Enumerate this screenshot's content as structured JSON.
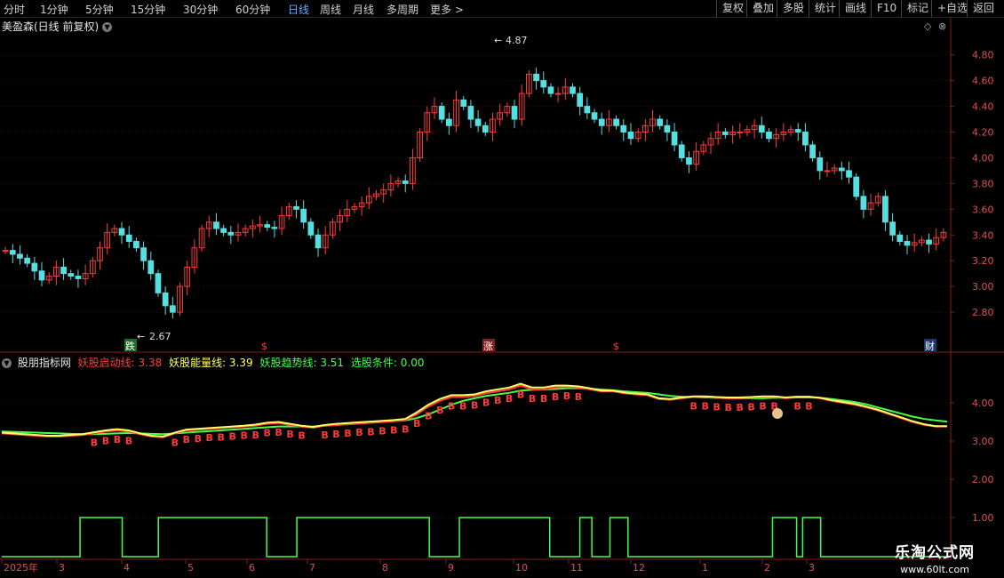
{
  "toolbar": {
    "periods": [
      "分时",
      "1分钟",
      "5分钟",
      "15分钟",
      "30分钟",
      "60分钟",
      "日线",
      "周线",
      "月线",
      "多周期",
      "更多 >"
    ],
    "active_period": "日线",
    "right_buttons": [
      "复权",
      "叠加",
      "多股",
      "统计",
      "画线",
      "F10",
      "标记",
      "+自选",
      "返回"
    ]
  },
  "main_chart": {
    "stock_title": "美盈森(日线 前复权)",
    "high_label": "4.87",
    "low_label": "2.67",
    "y_ticks": [
      "4.80",
      "4.60",
      "4.40",
      "4.20",
      "4.00",
      "3.80",
      "3.60",
      "3.40",
      "3.20",
      "3.00",
      "2.80"
    ],
    "markers": [
      {
        "text": "跌",
        "type": "box-green"
      },
      {
        "text": "$",
        "type": "red"
      },
      {
        "text": "涨",
        "type": "box-red"
      },
      {
        "text": "$",
        "type": "red"
      },
      {
        "text": "财",
        "type": "box-blue"
      }
    ]
  },
  "indicator": {
    "name": "股朋指标网",
    "lines": [
      {
        "label": "妖股启动线: 3.38",
        "color": "#ff3b3b"
      },
      {
        "label": "妖股能量线: 3.39",
        "color": "#ffff66"
      },
      {
        "label": "妖股趋势线: 3.51",
        "color": "#44ff44"
      },
      {
        "label": "选股条件: 0.00",
        "color": "#44ff44"
      }
    ],
    "y_ticks": [
      "4.00",
      "3.00",
      "2.00",
      "1.00"
    ],
    "buy_marker": "B"
  },
  "x_axis": {
    "labels": [
      "2025年",
      "3",
      "4",
      "5",
      "6",
      "7",
      "8",
      "9",
      "10",
      "11",
      "12",
      "1",
      "2",
      "3"
    ]
  },
  "watermark": {
    "title": "乐淘公式网",
    "url": "www.60lt.com"
  },
  "chart_data": {
    "type": "candlestick",
    "title": "美盈森(日线 前复权)",
    "ylim": [
      2.6,
      4.95
    ],
    "series": [
      {
        "name": "K线",
        "close": [
          3.28,
          3.25,
          3.22,
          3.18,
          3.12,
          3.05,
          3.08,
          3.15,
          3.1,
          3.08,
          3.06,
          3.1,
          3.2,
          3.3,
          3.42,
          3.45,
          3.4,
          3.35,
          3.3,
          3.2,
          3.1,
          2.95,
          2.85,
          2.8,
          3.0,
          3.15,
          3.3,
          3.45,
          3.5,
          3.45,
          3.42,
          3.4,
          3.42,
          3.45,
          3.47,
          3.48,
          3.46,
          3.45,
          3.55,
          3.62,
          3.6,
          3.5,
          3.4,
          3.3,
          3.4,
          3.5,
          3.55,
          3.6,
          3.62,
          3.65,
          3.7,
          3.72,
          3.75,
          3.8,
          3.82,
          3.8,
          4.0,
          4.2,
          4.35,
          4.4,
          4.3,
          4.25,
          4.45,
          4.4,
          4.3,
          4.25,
          4.2,
          4.3,
          4.35,
          4.4,
          4.3,
          4.5,
          4.65,
          4.6,
          4.55,
          4.5,
          4.5,
          4.55,
          4.5,
          4.4,
          4.35,
          4.3,
          4.25,
          4.3,
          4.25,
          4.2,
          4.15,
          4.2,
          4.25,
          4.3,
          4.25,
          4.2,
          4.1,
          4.0,
          3.95,
          4.05,
          4.1,
          4.15,
          4.2,
          4.18,
          4.2,
          4.2,
          4.22,
          4.25,
          4.2,
          4.15,
          4.18,
          4.2,
          4.22,
          4.2,
          4.1,
          4.0,
          3.9,
          3.9,
          3.92,
          3.9,
          3.85,
          3.7,
          3.6,
          3.65,
          3.7,
          3.5,
          3.4,
          3.35,
          3.32,
          3.34,
          3.36,
          3.33,
          3.38,
          3.42
        ]
      }
    ],
    "indicator": {
      "start_line": [
        3.2,
        3.18,
        3.16,
        3.14,
        3.12,
        3.12,
        3.14,
        3.16,
        3.2,
        3.25,
        3.28,
        3.25,
        3.18,
        3.12,
        3.1,
        3.2,
        3.28,
        3.3,
        3.32,
        3.34,
        3.36,
        3.38,
        3.4,
        3.45,
        3.47,
        3.42,
        3.38,
        3.35,
        3.4,
        3.42,
        3.44,
        3.46,
        3.48,
        3.5,
        3.52,
        3.55,
        3.7,
        3.9,
        4.05,
        4.15,
        4.15,
        4.18,
        4.25,
        4.3,
        4.35,
        4.45,
        4.35,
        4.35,
        4.4,
        4.42,
        4.4,
        4.35,
        4.3,
        4.3,
        4.25,
        4.22,
        4.2,
        4.1,
        4.08,
        4.12,
        4.15,
        4.15,
        4.13,
        4.12,
        4.12,
        4.13,
        4.15,
        4.15,
        4.12,
        4.15,
        4.15,
        4.12,
        4.05,
        4.0,
        3.95,
        3.88,
        3.8,
        3.7,
        3.6,
        3.5,
        3.42,
        3.38,
        3.38
      ],
      "energy_line": [
        3.22,
        3.2,
        3.18,
        3.16,
        3.14,
        3.14,
        3.16,
        3.18,
        3.23,
        3.28,
        3.31,
        3.28,
        3.2,
        3.14,
        3.12,
        3.22,
        3.3,
        3.32,
        3.34,
        3.36,
        3.38,
        3.4,
        3.43,
        3.48,
        3.5,
        3.45,
        3.4,
        3.37,
        3.42,
        3.45,
        3.47,
        3.49,
        3.51,
        3.53,
        3.55,
        3.58,
        3.75,
        3.95,
        4.1,
        4.2,
        4.2,
        4.22,
        4.3,
        4.35,
        4.4,
        4.5,
        4.4,
        4.4,
        4.45,
        4.45,
        4.43,
        4.38,
        4.32,
        4.32,
        4.27,
        4.24,
        4.22,
        4.12,
        4.1,
        4.14,
        4.17,
        4.17,
        4.15,
        4.14,
        4.14,
        4.15,
        4.17,
        4.17,
        4.14,
        4.16,
        4.16,
        4.13,
        4.07,
        4.02,
        3.97,
        3.9,
        3.82,
        3.72,
        3.62,
        3.52,
        3.44,
        3.39,
        3.39
      ],
      "trend_line": [
        3.25,
        3.24,
        3.23,
        3.22,
        3.21,
        3.2,
        3.19,
        3.18,
        3.18,
        3.19,
        3.2,
        3.21,
        3.2,
        3.19,
        3.18,
        3.2,
        3.22,
        3.24,
        3.26,
        3.28,
        3.3,
        3.32,
        3.34,
        3.36,
        3.38,
        3.38,
        3.38,
        3.38,
        3.4,
        3.42,
        3.44,
        3.46,
        3.48,
        3.5,
        3.52,
        3.54,
        3.6,
        3.7,
        3.82,
        3.95,
        4.05,
        4.12,
        4.18,
        4.22,
        4.26,
        4.32,
        4.34,
        4.35,
        4.36,
        4.38,
        4.38,
        4.37,
        4.35,
        4.33,
        4.3,
        4.28,
        4.26,
        4.22,
        4.18,
        4.16,
        4.15,
        4.14,
        4.13,
        4.12,
        4.12,
        4.12,
        4.12,
        4.13,
        4.13,
        4.14,
        4.14,
        4.13,
        4.1,
        4.06,
        4.02,
        3.96,
        3.88,
        3.8,
        3.72,
        3.64,
        3.58,
        3.54,
        3.51
      ],
      "select_condition": [
        0,
        0,
        0,
        0,
        0,
        0,
        0,
        0,
        0,
        0,
        0,
        0,
        0,
        1,
        1,
        1,
        1,
        1,
        1,
        1,
        0,
        0,
        0,
        0,
        0,
        0,
        1,
        1,
        1,
        1,
        1,
        1,
        1,
        1,
        1,
        1,
        1,
        1,
        1,
        1,
        1,
        1,
        1,
        1,
        0,
        0,
        0,
        0,
        0,
        1,
        1,
        1,
        1,
        1,
        1,
        1,
        1,
        1,
        1,
        1,
        1,
        1,
        1,
        1,
        1,
        1,
        1,
        1,
        1,
        1,
        1,
        0,
        0,
        0,
        0,
        0,
        1,
        1,
        1,
        1,
        1,
        1,
        1,
        1,
        1,
        1,
        1,
        1,
        1,
        1,
        1,
        0,
        0,
        0,
        0,
        0,
        1,
        1,
        0,
        0,
        0,
        1,
        1,
        1,
        0,
        0,
        0,
        0,
        0,
        0,
        0,
        0,
        0,
        0,
        0,
        0,
        0,
        0,
        0,
        0,
        0,
        0,
        0,
        0,
        0,
        0,
        0,
        0,
        1,
        1,
        1,
        1,
        0,
        1,
        1,
        1,
        0,
        0,
        0,
        0,
        0,
        0,
        0,
        0,
        0,
        0,
        0,
        0,
        0,
        0,
        0,
        0,
        0,
        0,
        0,
        0,
        0
      ],
      "ylim": [
        1.0,
        5.0
      ]
    }
  }
}
